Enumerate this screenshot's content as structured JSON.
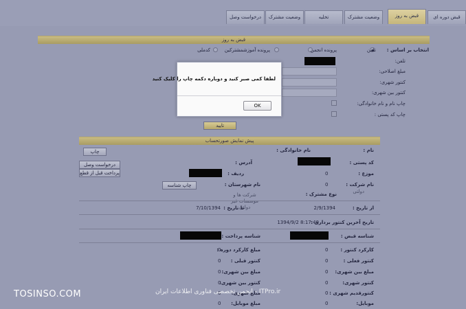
{
  "tabs": [
    {
      "label": "قبض دوره ای"
    },
    {
      "label": "قبض به روز"
    },
    {
      "label": "وضعیت مشترک"
    },
    {
      "label": "تخلیه"
    },
    {
      "label": "وضعیت مشترک"
    },
    {
      "label": "درخواست وصل"
    }
  ],
  "search": {
    "bar_title": "قبض به روز",
    "select_by_label": "انتخاب بر اساس :",
    "radio_phone": "تلفن",
    "radio_student": "پرونده انجمن",
    "radio_edu": "پرونده آموزشمشترکین",
    "radio_code": "کدملی",
    "phone_label": "تلفن:",
    "fix_amount_label": "مبلغ اصلاحی:",
    "intercity_meter_label": "کنتور شهری:",
    "intl_meter_label": "کنتور بین شهری:",
    "print_name_label": "چاپ نام و نام خانوادگی:",
    "print_postal_label": "چاپ کد پستی :",
    "confirm_button": "تایید"
  },
  "preview": {
    "bar_title": "پیش نمایش صورتحساب",
    "print_button": "چاپ",
    "request_connect_button": "درخواست وصل",
    "pay_before_cut_button": "پرداخت قبل از قطع",
    "name_label": "نام :",
    "family_label": "نام خانوادگی :",
    "postal_label": "کد پستی :",
    "address_label": "آدرس :",
    "row_label": "ردیف :",
    "area_label": "موزع :",
    "city_name_label": "نام شهرستان :",
    "city_id_button": "چاپ شناسه",
    "company_label": "نام شرکت :",
    "company_value": "دولتی",
    "sub_type_label": "نوع مشترک :",
    "sub_type_value": "شرکت ها و موسسات غیر دولتی",
    "from_date_label": "از تاریخ :",
    "from_date_value": "2/9/1394",
    "to_date_label": "تا تاریخ :",
    "to_date_value": "7/10/1394",
    "last_read_label": "تاریخ آخرین کنتور برداری :",
    "last_read_value": "1394/9/2 8:17:40",
    "bill_id_label": "شناسه قبض :",
    "pay_id_label": "شناسه پرداخت :"
  },
  "costs": {
    "left": [
      {
        "label": "مبلغ کارکرد دوره :",
        "value": "0"
      },
      {
        "label": "کنتور قبلی :",
        "value": "0"
      },
      {
        "label": "مبلغ بین شهری:",
        "value": "0"
      },
      {
        "label": "کنتور بین شهری:",
        "value": "0"
      },
      {
        "label": "مبلغ شهری:",
        "value": "0"
      },
      {
        "label": "مبلغ موبایل:",
        "value": "0"
      }
    ],
    "right": [
      {
        "label": "کارکرد کنتور :",
        "value": "0"
      },
      {
        "label": "کنتور فعلی :",
        "value": "0"
      },
      {
        "label": "مبلغ بین شهری:",
        "value": "0"
      },
      {
        "label": "کنتور شهری:",
        "value": "0"
      },
      {
        "label": "کنتورقدیم شهری :",
        "value": "0"
      },
      {
        "label": "موبایل:",
        "value": "0"
      }
    ]
  },
  "modal": {
    "message": "لطفا کمی صبر کنید و دوباره دکمه چاپ را کلیک کنید",
    "ok_label": "OK"
  },
  "watermark": {
    "left": "TOSINSO.COM",
    "center": "ITPro.ir - انجمن تخصصی فناوری اطلاعات ایران"
  }
}
